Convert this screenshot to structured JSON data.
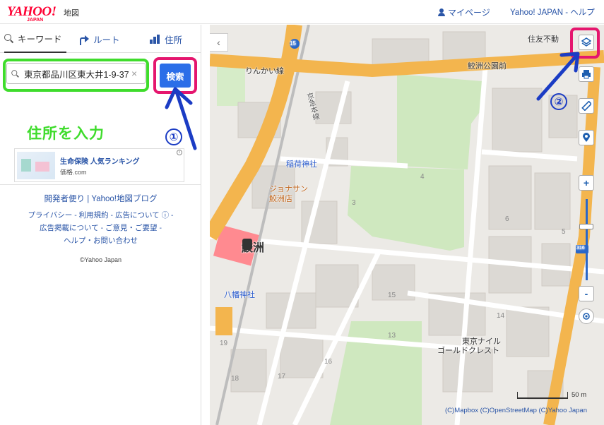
{
  "header": {
    "logo_text": "YAHOO!",
    "logo_sub": "JAPAN",
    "logo_map": "地図",
    "mypage_label": "マイページ",
    "links": "Yahoo! JAPAN - ヘルプ"
  },
  "tabs": [
    {
      "label": "キーワード",
      "icon": "search-icon"
    },
    {
      "label": "ルート",
      "icon": "route-icon"
    },
    {
      "label": "住所",
      "icon": "address-icon"
    }
  ],
  "search": {
    "value": "東京都品川区東大井1-9-37",
    "clear_symbol": "×",
    "button_label": "検索"
  },
  "annotations": {
    "input_hint": "住所を入力",
    "step1": "①",
    "step2": "②",
    "highlight_green": "#3fdc2c",
    "highlight_pink": "#e5166e",
    "arrow_blue": "#1b3cc4"
  },
  "ad": {
    "title": "生命保険 人気ランキング",
    "sub": "価格.com"
  },
  "footer": {
    "row1": "開発者便り | Yahoo!地図ブログ",
    "row2": "プライバシー - 利用規約 - 広告について ⓘ -",
    "row3": "広告掲載について - ご意見・ご要望 -",
    "row4": "ヘルプ・お問い合わせ",
    "copyright": "©Yahoo Japan"
  },
  "map": {
    "collapse_symbol": "‹",
    "labels": {
      "rinkai": "りんかい線",
      "keikyu": "京急本線",
      "samezu_park": "鮫洲公園前",
      "inari": "稲荷神社",
      "jonathan": "ジョナサン",
      "jonathan_branch": "鮫洲店",
      "station": "鮫洲",
      "hachiman": "八幡神社",
      "nile_1": "東京ナイル",
      "nile_2": "ゴールドクレスト",
      "sumitomo": "住友不動"
    },
    "route_numbers": {
      "r15": "15",
      "r316": "316"
    },
    "blocks": [
      "4",
      "3",
      "6",
      "5",
      "15",
      "14",
      "16",
      "13",
      "17",
      "18",
      "19"
    ],
    "zoom_in": "+",
    "zoom_out": "-",
    "scale_label": "50 m",
    "attribution": "(C)Mapbox (C)OpenStreetMap (C)Yahoo Japan",
    "colors": {
      "expressway": "#f3b54e",
      "park": "#cfe8bf",
      "rail": "#ff8a90"
    }
  }
}
